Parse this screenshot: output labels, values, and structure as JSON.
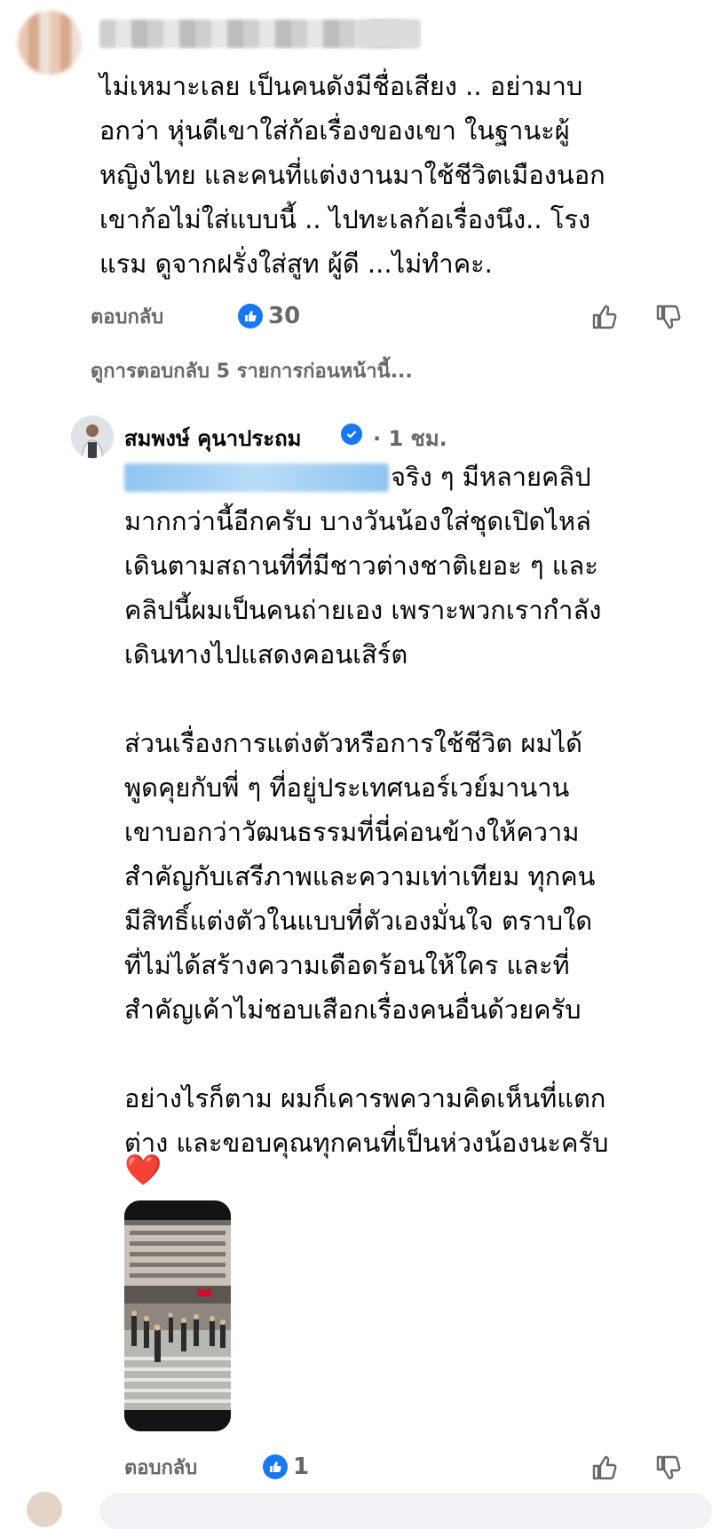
{
  "top_comment": {
    "text": "ไม่เหมาะเลย เป็นคนดังมีชื่อเสียง .. อย่ามาบ\nอกว่า หุ่นดีเขาใส่ก้อเรื่องของเขา ในฐานะผู้\nหญิงไทย และคนที่แต่งงานมาใช้ชีวิตเมืองนอก\nเขาก้อไม่ใส่แบบนี้ .. ไปทะเลก้อเรื่องนึง.. โรง\nแรม ดูจากฝรั่งใส่สูท ผู้ดี ...ไม่ทำคะ.",
    "reply_label": "ตอบกลับ",
    "like_count": "30"
  },
  "previous_replies": "ดูการตอบกลับ 5 รายการก่อนหน้านี้...",
  "reply": {
    "author": "สมพงษ์ คุนาประถม",
    "time": "· 1 ชม.",
    "first_line": "จริง ๆ มีหลายคลิป",
    "body": "มากกว่านี้อีกครับ บางวันน้องใส่ชุดเปิดไหล่\nเดินตามสถานที่ที่มีชาวต่างชาติเยอะ ๆ และ\nคลิปนี้ผมเป็นคนถ่ายเอง เพราะพวกเรากำลัง\nเดินทางไปแสดงคอนเสิร์ต\n\nส่วนเรื่องการแต่งตัวหรือการใช้ชีวิต ผมได้\nพูดคุยกับพี่ ๆ ที่อยู่ประเทศนอร์เวย์มานาน\nเขาบอกว่าวัฒนธรรมที่นี่ค่อนข้างให้ความ\nสำคัญกับเสรีภาพและความเท่าเทียม ทุกคน\nมีสิทธิ์แต่งตัวในแบบที่ตัวเองมั่นใจ ตราบใด\nที่ไม่ได้สร้างความเดือดร้อนให้ใคร และที่\nสำคัญเค้าไม่ชอบเสือกเรื่องคนอื่นด้วยครับ\n\nอย่างไรก็ตาม ผมก็เคารพความคิดเห็นที่แตก\nต่าง และขอบคุณทุกคนที่เป็นห่วงน้องนะครับ",
    "heart": "❤️",
    "reply_label": "ตอบกลับ",
    "like_count": "1"
  },
  "colors": {
    "accent": "#1877f2",
    "secondary_text": "#65676b",
    "heart": "#e0245e"
  }
}
